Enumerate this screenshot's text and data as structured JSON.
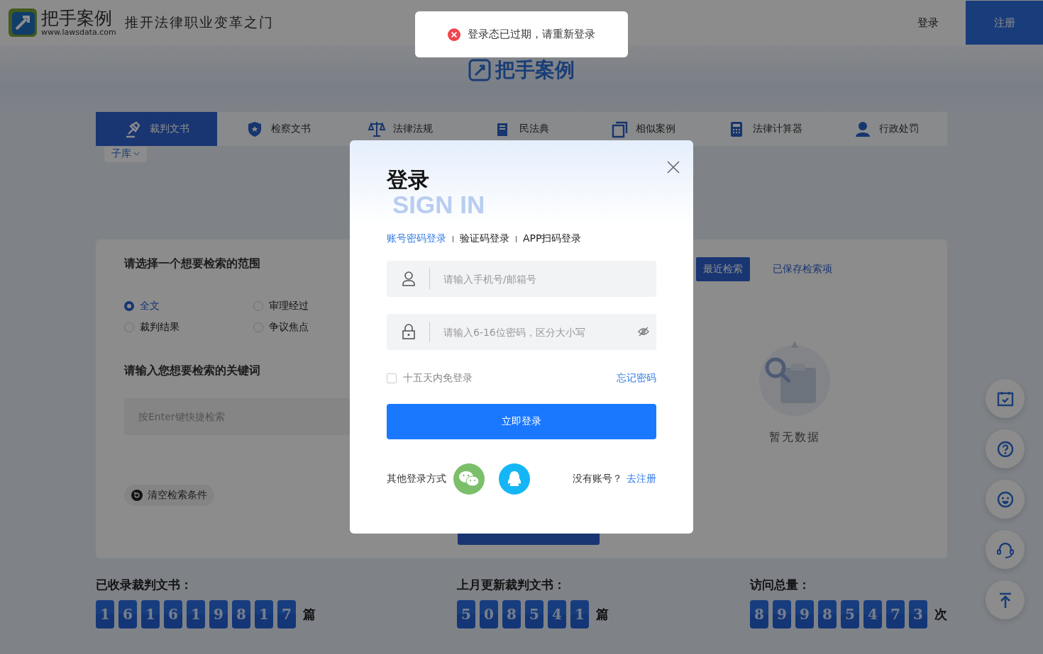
{
  "header": {
    "logo_name": "把手案例",
    "logo_url": "www.lawsdata.com",
    "slogan": "推开法律职业变革之门",
    "login": "登录",
    "register": "注册"
  },
  "banner": {
    "logo_text": "把手案例"
  },
  "nav_tabs": [
    {
      "label": "裁判文书",
      "selected": true
    },
    {
      "label": "检察文书",
      "selected": false
    },
    {
      "label": "法律法规",
      "selected": false
    },
    {
      "label": "民法典",
      "selected": false
    },
    {
      "label": "相似案例",
      "selected": false
    },
    {
      "label": "法律计算器",
      "selected": false
    },
    {
      "label": "行政处罚",
      "selected": false
    }
  ],
  "sub_library": "子库",
  "search_panel": {
    "scope_title": "请选择一个想要检索的范围",
    "scope_options": [
      {
        "label": "全文",
        "selected": true
      },
      {
        "label": "审理经过",
        "selected": false
      },
      {
        "label": "裁判结果",
        "selected": false
      },
      {
        "label": "争议焦点",
        "selected": false
      }
    ],
    "keyword_title": "请输入您想要检索的关键词",
    "keyword_placeholder": "按Enter键快捷检索",
    "clear_button": "清空检索条件"
  },
  "history": {
    "tabs": [
      {
        "label": "最近检索",
        "selected": true
      },
      {
        "label": "已保存检索项",
        "selected": false
      }
    ],
    "empty_text": "暂无数据"
  },
  "stats": [
    {
      "label": "已收录裁判文书：",
      "digits": [
        "1",
        "6",
        "1",
        "6",
        "1",
        "9",
        "8",
        "1",
        "7"
      ],
      "unit": "篇"
    },
    {
      "label": "上月更新裁判文书：",
      "digits": [
        "5",
        "0",
        "8",
        "5",
        "4",
        "1"
      ],
      "unit": "篇"
    },
    {
      "label": "访问总量：",
      "digits": [
        "8",
        "9",
        "9",
        "8",
        "5",
        "4",
        "7",
        "3"
      ],
      "unit": "次"
    }
  ],
  "toast": {
    "kind": "error",
    "text": "登录态已过期，请重新登录"
  },
  "login_modal": {
    "title": "登录",
    "watermark": "SIGN IN",
    "methods": [
      {
        "label": "账号密码登录",
        "selected": true
      },
      {
        "label": "验证码登录",
        "selected": false
      },
      {
        "label": "APP扫码登录",
        "selected": false
      }
    ],
    "account_placeholder": "请输入手机号/邮箱号",
    "password_placeholder": "请输入6-16位密码，区分大小写",
    "remember": {
      "label": "十五天内免登录",
      "checked": false
    },
    "forgot": "忘记密码",
    "submit": "立即登录",
    "other_label": "其他登录方式",
    "no_account": "没有账号？",
    "register_link": "去注册"
  }
}
